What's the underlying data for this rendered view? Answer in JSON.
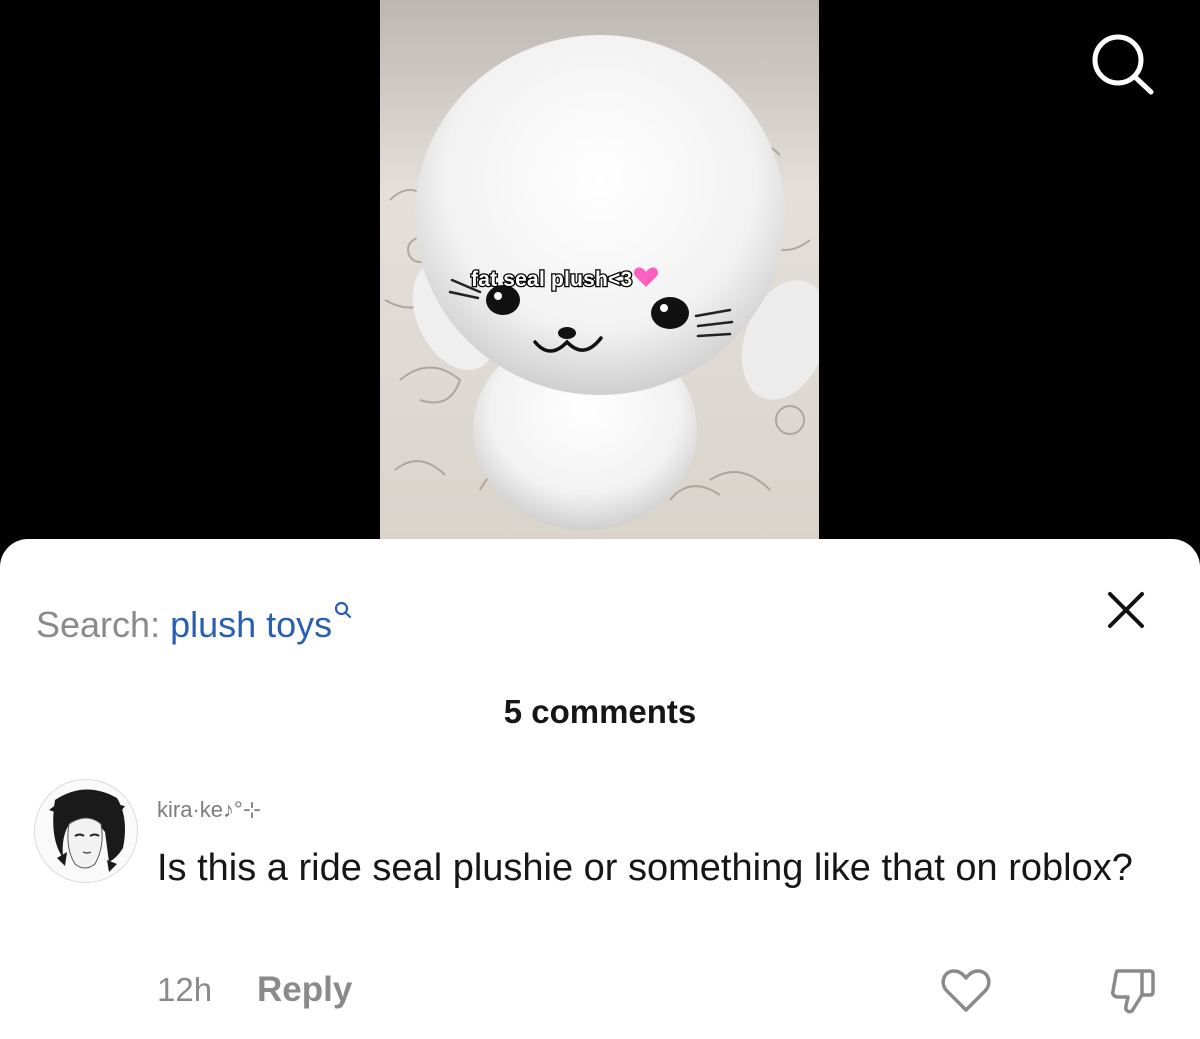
{
  "video": {
    "caption": "fat seal plush<3",
    "caption_emoji": "pink-heart-icon",
    "search_icon": "search-icon"
  },
  "sheet": {
    "search_prefix": "Search:",
    "search_term": "plush toys",
    "search_term_color": "#2a5fb0",
    "search_term_icon": "small-search-icon",
    "close_icon": "close-icon",
    "comment_count": "5 comments"
  },
  "comment": {
    "username": "kira·ke♪°⊹",
    "text": "Is this a ride seal plushie or something like that on roblox?",
    "time": "12h",
    "reply_label": "Reply",
    "like_icon": "heart-outline-icon",
    "dislike_icon": "thumbs-down-icon"
  }
}
